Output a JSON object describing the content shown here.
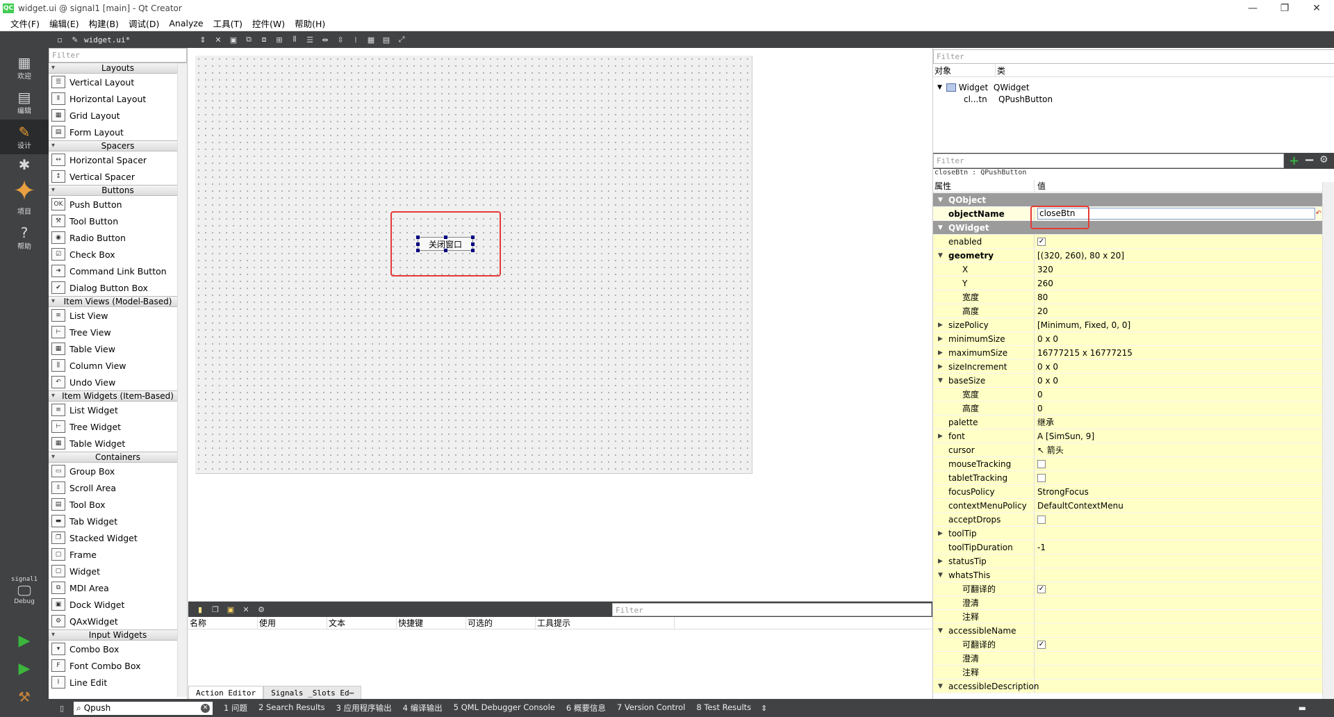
{
  "window": {
    "title": "widget.ui @ signal1 [main] - Qt Creator",
    "app_icon": "QC"
  },
  "menu": [
    "文件(F)",
    "编辑(E)",
    "构建(B)",
    "调试(D)",
    "Analyze",
    "工具(T)",
    "控件(W)",
    "帮助(H)"
  ],
  "modes": {
    "welcome": "欢迎",
    "edit": "编辑",
    "design": "设计",
    "debug": "Debug",
    "projects": "项目",
    "help": "帮助",
    "kit_project": "signal1",
    "kit_mode": "Debug"
  },
  "doc_toolbar": {
    "file_name": "widget.ui*"
  },
  "widget_box": {
    "filter_placeholder": "Filter",
    "categories": [
      {
        "name": "Layouts",
        "items": [
          "Vertical Layout",
          "Horizontal Layout",
          "Grid Layout",
          "Form Layout"
        ]
      },
      {
        "name": "Spacers",
        "items": [
          "Horizontal Spacer",
          "Vertical Spacer"
        ]
      },
      {
        "name": "Buttons",
        "items": [
          "Push Button",
          "Tool Button",
          "Radio Button",
          "Check Box",
          "Command Link Button",
          "Dialog Button Box"
        ]
      },
      {
        "name": "Item Views (Model-Based)",
        "items": [
          "List View",
          "Tree View",
          "Table View",
          "Column View",
          "Undo View"
        ]
      },
      {
        "name": "Item Widgets (Item-Based)",
        "items": [
          "List Widget",
          "Tree Widget",
          "Table Widget"
        ]
      },
      {
        "name": "Containers",
        "items": [
          "Group Box",
          "Scroll Area",
          "Tool Box",
          "Tab Widget",
          "Stacked Widget",
          "Frame",
          "Widget",
          "MDI Area",
          "Dock Widget",
          "QAxWidget"
        ]
      },
      {
        "name": "Input Widgets",
        "items": [
          "Combo Box",
          "Font Combo Box",
          "Line Edit"
        ]
      }
    ]
  },
  "form": {
    "button_text": "关闭窗口"
  },
  "action_editor": {
    "filter_placeholder": "Filter",
    "columns": [
      "名称",
      "使用",
      "文本",
      "快捷键",
      "可选的",
      "工具提示"
    ],
    "tabs": [
      "Action Editor",
      "Signals _Slots Ed⋯"
    ]
  },
  "object_inspector": {
    "filter_placeholder": "Filter",
    "columns": [
      "对象",
      "类"
    ],
    "rows": [
      {
        "object": "Widget",
        "class": "QWidget"
      },
      {
        "object": "cl...tn",
        "class": "QPushButton"
      }
    ]
  },
  "property_editor": {
    "filter_placeholder": "Filter",
    "object_line": "closeBtn : QPushButton",
    "columns": [
      "属性",
      "值"
    ],
    "rows": [
      {
        "type": "group",
        "key": "QObject",
        "value": ""
      },
      {
        "type": "edit",
        "key": "objectName",
        "value": "closeBtn"
      },
      {
        "type": "group",
        "key": "QWidget",
        "value": ""
      },
      {
        "type": "check",
        "key": "enabled",
        "value": "✓"
      },
      {
        "type": "expanded",
        "key": "geometry",
        "value": "[(320, 260), 80 x 20]"
      },
      {
        "type": "sub",
        "key": "X",
        "value": "320"
      },
      {
        "type": "sub",
        "key": "Y",
        "value": "260"
      },
      {
        "type": "sub",
        "key": "宽度",
        "value": "80"
      },
      {
        "type": "sub",
        "key": "高度",
        "value": "20"
      },
      {
        "type": "collapsed",
        "key": "sizePolicy",
        "value": "[Minimum, Fixed, 0, 0]"
      },
      {
        "type": "collapsed",
        "key": "minimumSize",
        "value": "0 x 0"
      },
      {
        "type": "collapsed",
        "key": "maximumSize",
        "value": "16777215 x 16777215"
      },
      {
        "type": "collapsed",
        "key": "sizeIncrement",
        "value": "0 x 0"
      },
      {
        "type": "expanded",
        "key": "baseSize",
        "value": "0 x 0"
      },
      {
        "type": "sub",
        "key": "宽度",
        "value": "0"
      },
      {
        "type": "sub",
        "key": "高度",
        "value": "0"
      },
      {
        "type": "plain",
        "key": "palette",
        "value": "继承"
      },
      {
        "type": "collapsed",
        "key": "font",
        "value": "A  [SimSun, 9]"
      },
      {
        "type": "plain",
        "key": "cursor",
        "value": "↖  箭头"
      },
      {
        "type": "check",
        "key": "mouseTracking",
        "value": ""
      },
      {
        "type": "check",
        "key": "tabletTracking",
        "value": ""
      },
      {
        "type": "plain",
        "key": "focusPolicy",
        "value": "StrongFocus"
      },
      {
        "type": "plain",
        "key": "contextMenuPolicy",
        "value": "DefaultContextMenu"
      },
      {
        "type": "check",
        "key": "acceptDrops",
        "value": ""
      },
      {
        "type": "collapsed",
        "key": "toolTip",
        "value": ""
      },
      {
        "type": "plain",
        "key": "toolTipDuration",
        "value": "-1"
      },
      {
        "type": "collapsed",
        "key": "statusTip",
        "value": ""
      },
      {
        "type": "expanded",
        "key": "whatsThis",
        "value": ""
      },
      {
        "type": "subcheck",
        "key": "可翻译的",
        "value": "✓"
      },
      {
        "type": "sub",
        "key": "澄清",
        "value": ""
      },
      {
        "type": "sub",
        "key": "注释",
        "value": ""
      },
      {
        "type": "expanded",
        "key": "accessibleName",
        "value": ""
      },
      {
        "type": "subcheck",
        "key": "可翻译的",
        "value": "✓"
      },
      {
        "type": "sub",
        "key": "澄清",
        "value": ""
      },
      {
        "type": "sub",
        "key": "注释",
        "value": ""
      },
      {
        "type": "expanded",
        "key": "accessibleDescription",
        "value": ""
      }
    ]
  },
  "status_bar": {
    "locator_value": "Qpush",
    "panes": [
      "1  问题",
      "2  Search Results",
      "3  应用程序输出",
      "4  编译输出",
      "5  QML Debugger Console",
      "6  概要信息",
      "7  Version Control",
      "8  Test Results"
    ]
  },
  "colors": {
    "dark_panel": "#404244",
    "selection_handle": "#000080",
    "highlight_box": "#e53935",
    "property_yellow": "#ffffc6",
    "group_gray": "#9b9b9b",
    "qt_green": "#41cd52"
  }
}
